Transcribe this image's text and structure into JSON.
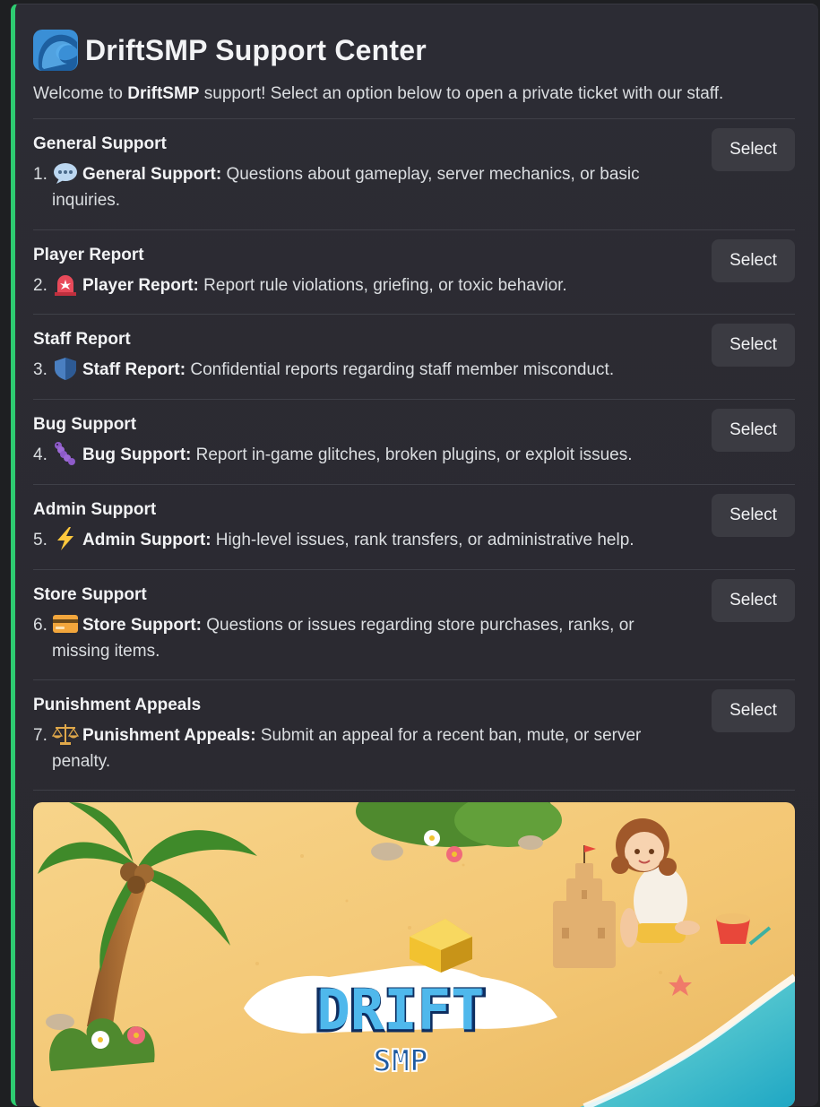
{
  "header": {
    "title": "DriftSMP Support Center",
    "welcome_prefix": "Welcome to ",
    "welcome_brand": "DriftSMP",
    "welcome_suffix": " support! Select an option below to open a private ticket with our staff."
  },
  "sections": [
    {
      "title": "General Support",
      "number": "1.",
      "icon": "speech-bubble-icon",
      "bold": "General Support:",
      "text": " Questions about gameplay, server mechanics, or basic inquiries.",
      "button": "Select"
    },
    {
      "title": "Player Report",
      "number": "2.",
      "icon": "siren-icon",
      "bold": "Player Report:",
      "text": " Report rule violations, griefing, or toxic behavior.",
      "button": "Select"
    },
    {
      "title": "Staff Report",
      "number": "3.",
      "icon": "shield-icon",
      "bold": "Staff Report:",
      "text": " Confidential reports regarding staff member misconduct.",
      "button": "Select"
    },
    {
      "title": "Bug Support",
      "number": "4.",
      "icon": "bug-worm-icon",
      "bold": "Bug Support:",
      "text": " Report in-game glitches, broken plugins, or exploit issues.",
      "button": "Select"
    },
    {
      "title": "Admin Support",
      "number": "5.",
      "icon": "lightning-icon",
      "bold": "Admin Support:",
      "text": " High-level issues, rank transfers, or administrative help.",
      "button": "Select"
    },
    {
      "title": "Store Support",
      "number": "6.",
      "icon": "credit-card-icon",
      "bold": "Store Support:",
      "text": " Questions or issues regarding store purchases, ranks, or missing items.",
      "button": "Select"
    },
    {
      "title": "Punishment Appeals",
      "number": "7.",
      "icon": "scales-icon",
      "bold": "Punishment Appeals:",
      "text": " Submit an appeal for a recent ban, mute, or server penalty.",
      "button": "Select"
    }
  ],
  "banner": {
    "logo_line1": "DRIFT",
    "logo_line2": "SMP"
  },
  "colors": {
    "accent_bar": "#2ecc71",
    "button_bg": "#3b3b42",
    "embed_bg": "#2c2c34"
  }
}
